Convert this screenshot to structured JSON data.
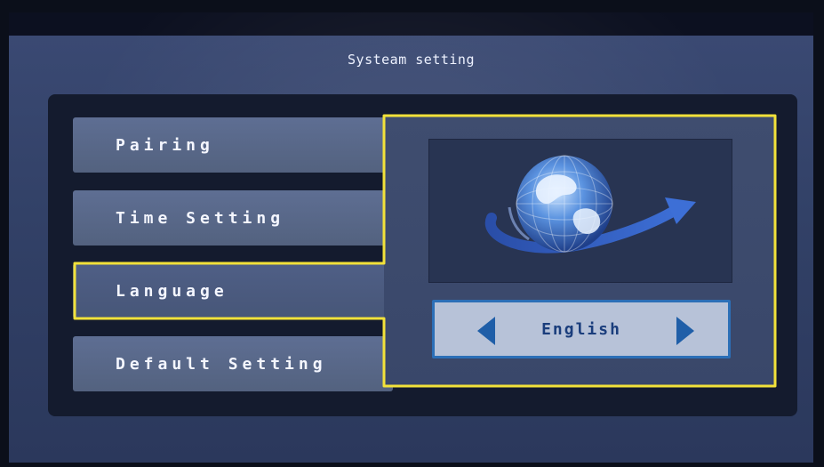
{
  "screen": {
    "title": "Systeam setting"
  },
  "menu": {
    "items": [
      {
        "label": "Pairing",
        "selected": false
      },
      {
        "label": "Time Setting",
        "selected": false
      },
      {
        "label": "Language",
        "selected": true
      },
      {
        "label": "Default Setting",
        "selected": false
      }
    ]
  },
  "language": {
    "current_value": "English",
    "icon": "globe-icon"
  },
  "colors": {
    "highlight": "#f2e23a",
    "screen_bg": "#344369",
    "menu_item": "#5a6a8d",
    "selector_bg": "#b7c2d8",
    "selector_accent": "#1f5ea8"
  }
}
